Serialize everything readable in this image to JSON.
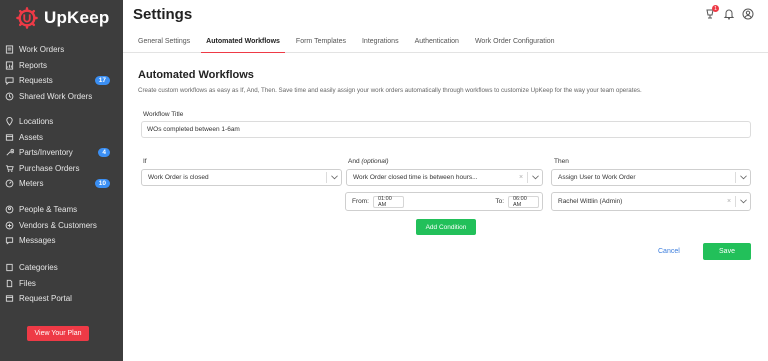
{
  "app": {
    "name": "UpKeep",
    "brand_color": "#ee3a46",
    "accent_green": "#22c05a",
    "link_blue": "#3b7ddd"
  },
  "sidebar": {
    "group1": [
      {
        "label": "Work Orders",
        "icon": "work-orders-icon"
      },
      {
        "label": "Reports",
        "icon": "reports-icon"
      },
      {
        "label": "Requests",
        "icon": "requests-icon",
        "badge": "17"
      },
      {
        "label": "Shared Work Orders",
        "icon": "shared-work-orders-icon"
      }
    ],
    "group2": [
      {
        "label": "Locations",
        "icon": "location-pin-icon"
      },
      {
        "label": "Assets",
        "icon": "assets-icon"
      },
      {
        "label": "Parts/Inventory",
        "icon": "wrench-icon",
        "badge": "4"
      },
      {
        "label": "Purchase Orders",
        "icon": "purchase-orders-icon"
      },
      {
        "label": "Meters",
        "icon": "meter-icon",
        "badge": "10"
      }
    ],
    "group3": [
      {
        "label": "People & Teams",
        "icon": "people-icon"
      },
      {
        "label": "Vendors & Customers",
        "icon": "vendors-icon"
      },
      {
        "label": "Messages",
        "icon": "messages-icon"
      }
    ],
    "group4": [
      {
        "label": "Categories",
        "icon": "categories-icon"
      },
      {
        "label": "Files",
        "icon": "files-icon"
      },
      {
        "label": "Request Portal",
        "icon": "request-portal-icon"
      }
    ],
    "plan_button": "View Your Plan"
  },
  "header": {
    "title": "Settings",
    "notification_count": "1"
  },
  "tabs": [
    {
      "label": "General Settings",
      "active": false
    },
    {
      "label": "Automated Workflows",
      "active": true
    },
    {
      "label": "Form Templates",
      "active": false
    },
    {
      "label": "Integrations",
      "active": false
    },
    {
      "label": "Authentication",
      "active": false
    },
    {
      "label": "Work Order Configuration",
      "active": false
    }
  ],
  "main": {
    "section_title": "Automated Workflows",
    "description": "Create custom workflows as easy as If, And, Then. Save time and easily assign your work orders automatically through workflows to customize UpKeep for the way your team operates.",
    "workflow_title_label": "Workflow Title",
    "workflow_title_value": "WOs completed between 1-6am",
    "if_label": "If",
    "and_label": "And",
    "and_optional": "(optional)",
    "then_label": "Then",
    "if_value": "Work Order is closed",
    "and_value": "Work Order closed time is between hours...",
    "then_value": "Assign User to Work Order",
    "then_user_value": "Rachel Wittlin (Admin)",
    "from_label": "From:",
    "from_value": "01:00 AM",
    "to_label": "To:",
    "to_value": "06:00 AM",
    "clear_symbol": "×",
    "add_condition": "Add Condition",
    "cancel": "Cancel",
    "save": "Save"
  }
}
